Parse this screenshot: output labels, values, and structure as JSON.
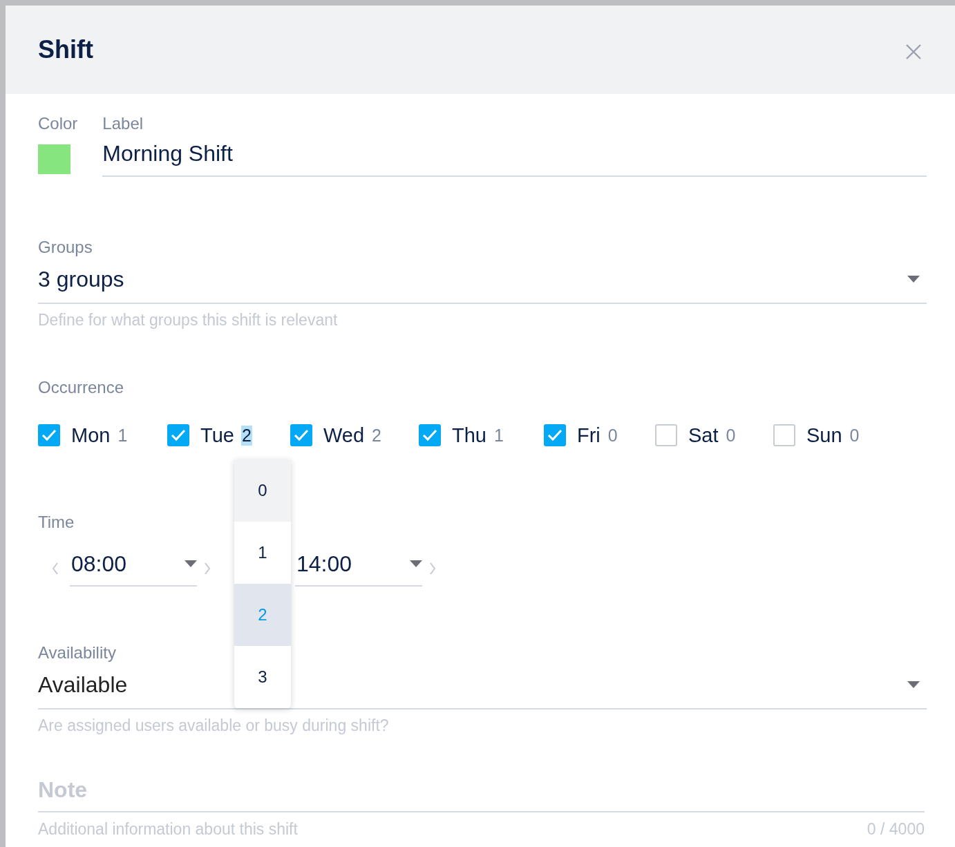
{
  "dialog": {
    "title": "Shift"
  },
  "color_field": {
    "label": "Color",
    "color": "#86e57f"
  },
  "label_field": {
    "label": "Label",
    "value": "Morning Shift"
  },
  "groups": {
    "label": "Groups",
    "value": "3 groups",
    "hint": "Define for what groups this shift is relevant"
  },
  "occurrence": {
    "label": "Occurrence",
    "days": [
      {
        "name": "Mon",
        "count": "1",
        "checked": true,
        "menu_open": false
      },
      {
        "name": "Tue",
        "count": "2",
        "checked": true,
        "menu_open": true
      },
      {
        "name": "Wed",
        "count": "2",
        "checked": true,
        "menu_open": false
      },
      {
        "name": "Thu",
        "count": "1",
        "checked": true,
        "menu_open": false
      },
      {
        "name": "Fri",
        "count": "0",
        "checked": true,
        "menu_open": false
      },
      {
        "name": "Sat",
        "count": "0",
        "checked": false,
        "menu_open": false
      },
      {
        "name": "Sun",
        "count": "0",
        "checked": false,
        "menu_open": false
      }
    ]
  },
  "count_menu": {
    "options": [
      {
        "label": "0",
        "highlighted": true,
        "selected": false
      },
      {
        "label": "1",
        "highlighted": false,
        "selected": false
      },
      {
        "label": "2",
        "highlighted": false,
        "selected": true
      },
      {
        "label": "3",
        "highlighted": false,
        "selected": false
      }
    ]
  },
  "time": {
    "label": "Time",
    "start": "08:00",
    "end": "14:00"
  },
  "availability": {
    "label": "Availability",
    "value": "Available",
    "hint": "Are assigned users available or busy during shift?"
  },
  "note": {
    "placeholder": "Note",
    "hint": "Additional information about this shift",
    "counter": "0 / 4000"
  }
}
